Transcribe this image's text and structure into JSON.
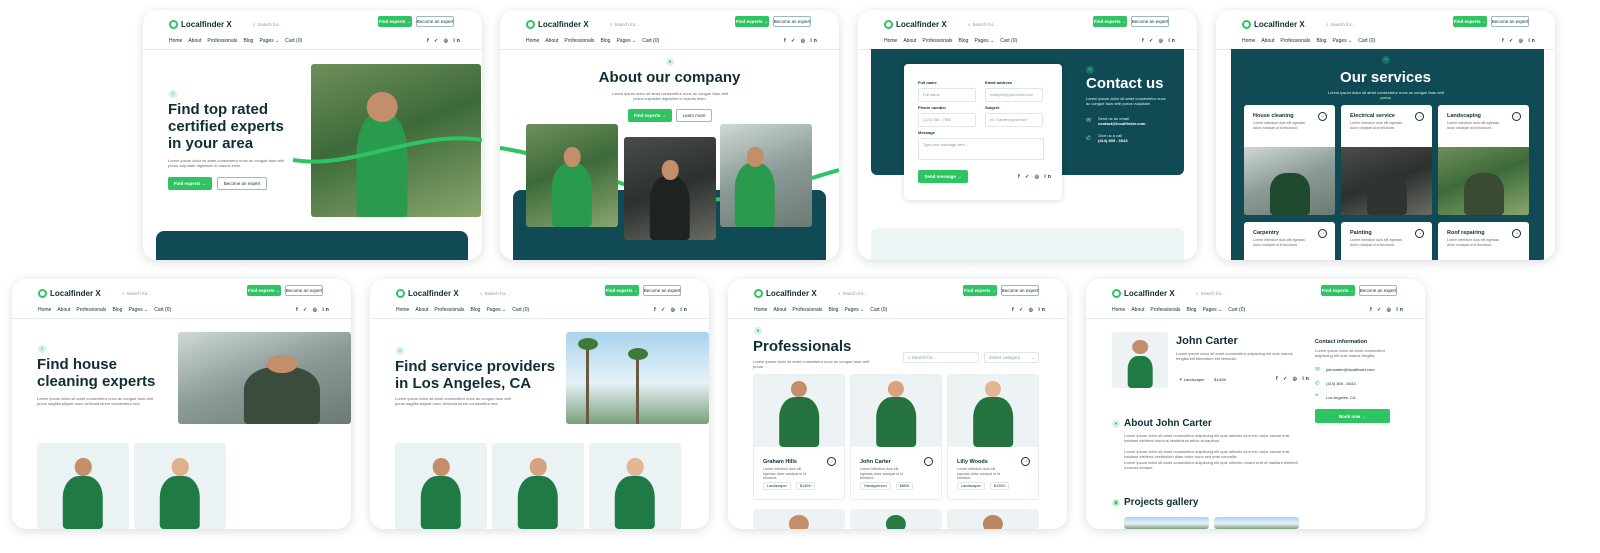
{
  "brand": {
    "name": "Localfinder X",
    "green": "#2ec463",
    "dark": "#0f4a55"
  },
  "header": {
    "search_placeholder": "Search for...",
    "find_experts": "Find experts →",
    "become_expert": "Become an expert",
    "nav": [
      "Home",
      "About",
      "Professionals",
      "Blog",
      "Pages ⌄",
      "Cart (0)"
    ],
    "social": "f ✓ ◎ in"
  },
  "home": {
    "title": "Find top rated certified experts in your area",
    "desc": "Lorem ipsum dolor sit amet consectetur nunc ac congue faus velit purus vulputate dignissim in mauris enim.",
    "cta_primary": "Find experts →",
    "cta_secondary": "Become an expert"
  },
  "about": {
    "title": "About our company",
    "desc": "Lorem ipsum dolor sit amet consectetur nunc ac congue faus velit purus vulputate dignissim in mauris enim.",
    "cta_primary": "Find experts →",
    "cta_secondary": "Learn more"
  },
  "contact": {
    "title": "Contact us",
    "desc": "Lorem ipsum dolor sit amet consectetur nunc ac congue faus velit purus vulputate.",
    "full_name_label": "Full name",
    "full_name_ph": "Full name",
    "email_label": "Email address",
    "email_ph": "example@youremail.com",
    "phone_label": "Phone number",
    "phone_ph": "(123) 456 - 7890",
    "subject_label": "Subject",
    "subject_ph": "ex. Gardening service",
    "message_label": "Message",
    "message_ph": "Type your message here...",
    "send": "Send message →",
    "email_info_label": "Send us an email",
    "email_info": "contact@localfinder.com",
    "phone_info_label": "Give us a call",
    "phone_info": "(414) 805 - 6043"
  },
  "services": {
    "title": "Our services",
    "desc": "Lorem ipsum dolor sit amet consectetur nunc ac congue faus velit purus.",
    "items": [
      {
        "name": "House cleaning",
        "desc": "Lorem interdum duis elit egestas dolor volutpat ut id tincidunt."
      },
      {
        "name": "Electrical service",
        "desc": "Lorem interdum duis elit egestas dolor volutpat ut id tincidunt."
      },
      {
        "name": "Landscaping",
        "desc": "Lorem interdum duis elit egestas dolor volutpat ut id tincidunt."
      },
      {
        "name": "Carpentry",
        "desc": "Lorem interdum duis elit egestas dolor volutpat ut id tincidunt."
      },
      {
        "name": "Painting",
        "desc": "Lorem interdum duis elit egestas dolor volutpat ut id tincidunt."
      },
      {
        "name": "Roof repairing",
        "desc": "Lorem interdum duis elit egestas dolor volutpat ut id tincidunt."
      }
    ]
  },
  "cleaning": {
    "title": "Find house cleaning experts",
    "desc": "Lorem ipsum dolor sit amet consectetur nunc ac congue faus velit purus sagittis aliquet nunc vehicula lorem consectetur sed."
  },
  "location": {
    "title": "Find service providers in Los Angeles, CA",
    "desc": "Lorem ipsum dolor sit amet consectetur nunc ac congue faus velit purus sagittis aliquet nunc vehicula lorem consectetur sed."
  },
  "professionals": {
    "title": "Professionals",
    "desc": "Lorem ipsum dolor sit amet consectetur nunc ac congue faus velit purus.",
    "search_ph": "Search for...",
    "category_ph": "Select category",
    "items": [
      {
        "name": "Graham Hills",
        "desc": "Lorem interdum duis elit egestas dolor volutpat ut id tincidunt.",
        "role": "Landscaper",
        "rate": "$140/h"
      },
      {
        "name": "John Carter",
        "desc": "Lorem interdum duis elit egestas dolor volutpat ut id tincidunt.",
        "role": "Handyperson",
        "rate": "$85/h"
      },
      {
        "name": "Lilly Woods",
        "desc": "Lorem interdum duis elit egestas dolor volutpat ut id tincidunt.",
        "role": "Landscaper",
        "rate": "$120/h"
      }
    ]
  },
  "profile": {
    "name": "John Carter",
    "desc": "Lorem ipsum dolor sit amet consectetur adipiscing elit duis mauris fringilla elit bibendum elit vehicula.",
    "role": "Landscaper",
    "rate": "$140/h",
    "about_title": "About John Carter",
    "about_p1": "Lorem ipsum dolor sit amet consectetur adipiscing elit quis ultricies sem nec dolor ornare erat habitant eleifend rhoncus vestibulum tellus at dapibus.",
    "about_p2": "Lorem ipsum dolor sit amet consectetur adipiscing elit quis ultricies sem nec dolor ornare erat habitant eleifend vestibulum diam tortor nunc sed ante convallis.",
    "about_p3": "Lorem ipsum dolor sit amet consectetur adipiscing elit quis ultricies ornare erat et habitant eleifend rhoncus semper.",
    "gallery_title": "Projects gallery",
    "contact_title": "Contact information",
    "contact_desc": "Lorem ipsum dolor sit amet consectetur adipiscing elit duis mauris fringilla.",
    "email": "johncarter@localfinder.com",
    "phone": "(414) 805 - 6043",
    "location": "Los Angeles, CA",
    "book": "Book now →"
  }
}
